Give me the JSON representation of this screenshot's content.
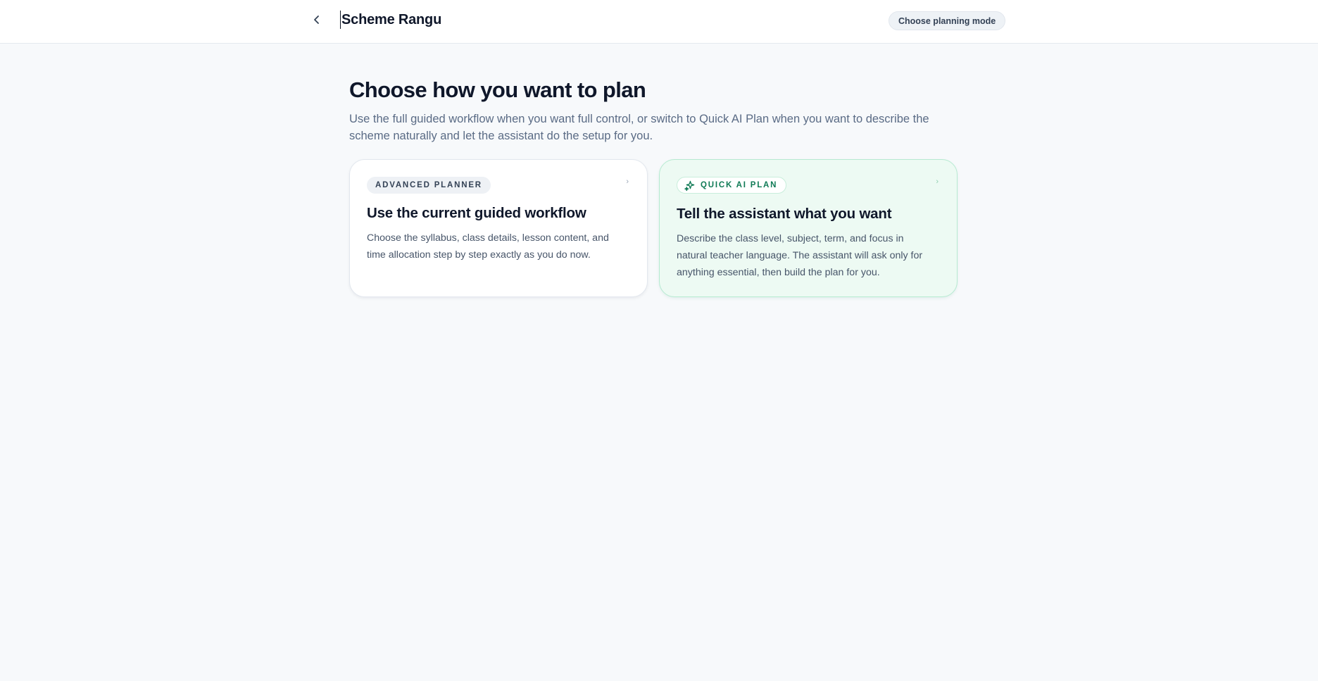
{
  "header": {
    "back_icon": "chevron-left-icon",
    "title": "Scheme Rangu",
    "mode_label": "Choose planning mode"
  },
  "main": {
    "heading": "Choose how you want to plan",
    "subheading": "Use the full guided workflow when you want full control, or switch to Quick AI Plan when you want to describe the scheme naturally and let the assistant do the setup for you."
  },
  "cards": {
    "advanced": {
      "badge": "ADVANCED PLANNER",
      "title": "Use the current guided workflow",
      "description": "Choose the syllabus, class details, lesson content, and time allocation step by step exactly as you do now.",
      "chevron_icon": "chevron-right-icon"
    },
    "quick_ai": {
      "badge": "QUICK AI PLAN",
      "badge_icon": "sparkle-icon",
      "title": "Tell the assistant what you want",
      "description": "Describe the class level, subject, term, and focus in natural teacher language. The assistant will ask only for anything essential, then build the plan for you.",
      "chevron_icon": "chevron-right-icon",
      "accent_color": "#0f7a55"
    }
  },
  "colors": {
    "page_bg": "#f7f9fb",
    "topbar_bg": "#ffffff",
    "heading": "#0f172a",
    "muted": "#5a6b85",
    "ai_card_bg": "#edfaf3",
    "ai_card_border": "#b6ead1"
  }
}
